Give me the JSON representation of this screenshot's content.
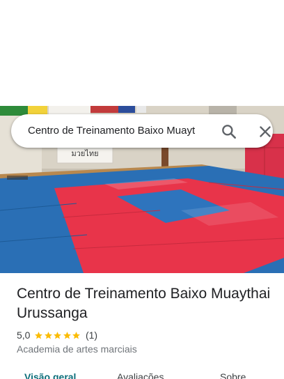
{
  "search": {
    "query": "Centro de Treinamento Baixo Muayt"
  },
  "hero": {
    "wall_sign_text": "มวยไทย"
  },
  "place": {
    "name": "Centro de Treinamento Baixo Muaythai Urussanga",
    "rating": "5,0",
    "stars": 5,
    "review_count": "(1)",
    "category": "Academia de artes marciais"
  },
  "tabs": [
    {
      "label": "Visão geral",
      "active": true
    },
    {
      "label": "Avaliações",
      "active": false
    },
    {
      "label": "Sobre",
      "active": false
    }
  ],
  "colors": {
    "star": "#fbbc04",
    "active_tab": "#0b6e7a",
    "mat_red": "#e8344a",
    "mat_blue": "#2a6fb5"
  },
  "icons": {
    "search": "search-icon",
    "close": "close-icon",
    "star": "star-icon"
  }
}
